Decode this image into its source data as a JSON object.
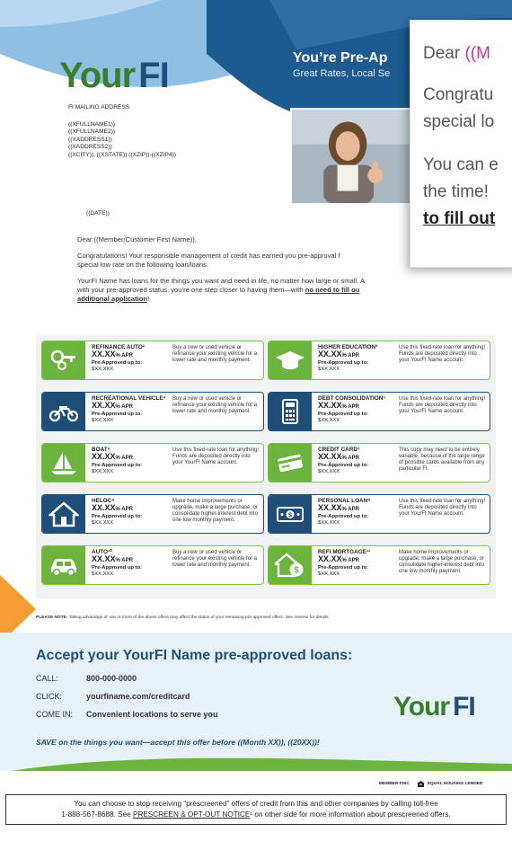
{
  "colors": {
    "brand_green": "#6cb33f",
    "brand_navy": "#1f4e79",
    "header_blue": "#1d5a8f",
    "accent_pink": "#c8358e",
    "accent_orange": "#f39c32"
  },
  "logo": {
    "part1": "Your",
    "part2": "FI"
  },
  "header": {
    "headline": "You’re Pre-Ap",
    "subline": "Great Rates, Local Se"
  },
  "address": {
    "label": "FI MAILING ADDRESS",
    "lines": [
      "((XFULLNAME1))",
      "((XFULLNAME2))",
      "((XADDRESS1))",
      "((XADDRESS2))",
      "((XCITY)), ((XSTATE)) ((XZIP))-((XZIP4))"
    ]
  },
  "date": "((DATE))",
  "letter": {
    "greeting": "Dear ((Member/Customer First Name)),",
    "p1": "Congratulations! Your responsible management of credit has earned you pre-approval f",
    "p1b": "special low rate on the following loan/loans.",
    "p2": "YourFI Name has loans for the things you want and need in life, no matter how large or small. A",
    "p2b": "with your pre-approved status, you’re one step closer to having them—with ",
    "p2_link": "no need to fill ou",
    "p2_link2": "additional application",
    "p2_end": "!"
  },
  "popup": {
    "line1_a": "Dear ",
    "line1_b": "((M",
    "line2": "Congratu",
    "line3": "special lo",
    "line4": "You can e",
    "line5": "the time!",
    "line6": "to fill out"
  },
  "offers": [
    {
      "name": "REFINANCE AUTO²",
      "rate": "XX.XX",
      "unit": "% APR",
      "pre": "Pre-Approved up to:",
      "amount": "$XX,XXX",
      "desc": "Buy a new or used vehicle or refinance your existing vehicle for a lower rate and monthly payment.",
      "icon": "car-keys-icon",
      "style": "green"
    },
    {
      "name": "HIGHER EDUCATION³",
      "rate": "XX.XX",
      "unit": "% APR",
      "pre": "Pre-Approved up to:",
      "amount": "$XX,XXX",
      "desc": "Use this fixed-rate loan for anything! Funds are deposited directly into your YourFI Name account.",
      "icon": "graduation-cap-icon",
      "style": "green"
    },
    {
      "name": "RECREATIONAL VEHICLE⁴",
      "rate": "XX.XX",
      "unit": "% APR",
      "pre": "Pre-Approved up to:",
      "amount": "$XX,XXX",
      "desc": "Buy a new or used vehicle or refinance your existing vehicle for a lower rate and monthly payment.",
      "icon": "motorcycle-icon",
      "style": "navy"
    },
    {
      "name": "DEBT CONSOLIDATION⁵",
      "rate": "XX.XX",
      "unit": "% APR",
      "pre": "Pre-Approved up to:",
      "amount": "$XX,XXX",
      "desc": "Use this fixed-rate loan for anything! Funds are deposited directly into your YourFI Name account.",
      "icon": "calculator-icon",
      "style": "navy"
    },
    {
      "name": "BOAT⁶",
      "rate": "XX.XX",
      "unit": "% APR",
      "pre": "Pre-Approved up to:",
      "amount": "$XX,XXX",
      "desc": "Use this fixed-rate loan for anything! Funds are deposited directly into your YourFI Name account.",
      "icon": "sailboat-icon",
      "style": "green"
    },
    {
      "name": "CREDIT CARD⁷",
      "rate": "XX.XX",
      "unit": "% APR",
      "pre": "Pre-Approved up to:",
      "amount": "$XX,XXX",
      "desc": "This copy may need to be entirely variable, because of the large range of possible cards available from any particular FI.",
      "icon": "credit-card-icon",
      "style": "green"
    },
    {
      "name": "HELOC⁸",
      "rate": "XX.XX",
      "unit": "% APR",
      "pre": "Pre-Approved up to:",
      "amount": "$XX,XXX",
      "desc": "Make home improvements or upgrade, make a large purchase, or consolidate higher-interest debt into one low monthly payment.",
      "icon": "house-icon",
      "style": "navy"
    },
    {
      "name": "PERSONAL LOAN⁹",
      "rate": "XX.XX",
      "unit": "% APR",
      "pre": "Pre-Approved up to:",
      "amount": "$XX,XXX",
      "desc": "Use this fixed-rate loan for anything! Funds are deposited directly into your YourFI Name account.",
      "icon": "cash-icon",
      "style": "navy"
    },
    {
      "name": "AUTO¹⁰",
      "rate": "XX.XX",
      "unit": "% APR",
      "pre": "Pre-Approved up to:",
      "amount": "$XX,XXX",
      "desc": "Buy a new or used vehicle or refinance your existing vehicle for a lower rate and monthly payment.",
      "icon": "car-icon",
      "style": "green"
    },
    {
      "name": "REFI MORTGAGE¹¹",
      "rate": "XX.XX",
      "unit": "% APR",
      "pre": "Pre-Approved up to:",
      "amount": "$XX,XXX",
      "desc": "Make home improvements or upgrade, make a large purchase, or consolidate higher-interest debt into one low monthly payment.",
      "icon": "house-dollar-icon",
      "style": "green"
    }
  ],
  "note": {
    "label": "PLEASE NOTE:",
    "text": " Taking advantage of one or more of the above offers may affect the status of your remaining pre-approved offers. See reverse for details."
  },
  "accept": {
    "title": "Accept your YourFI Name pre-approved loans:",
    "call_label": "CALL:",
    "call_value": "800-000-0000",
    "click_label": "CLICK:",
    "click_value": "yourfiname.com/creditcard",
    "comein_label": "COME IN:",
    "comein_value": "Convenient locations to serve you",
    "save": "SAVE on the things you want—accept this offer before ((Month XX)), ((20XX))!"
  },
  "legal": {
    "fdic": "MEMBER FDIC",
    "housing": "EQUAL HOUSING LENDER"
  },
  "optout": {
    "line1": "You can choose to stop receiving “prescreened” offers of credit from this and other companies by calling toll-free",
    "line2a": "1-888-567-8688. See ",
    "line2_link": "PRESCREEN & OPT-OUT NOTICE",
    "line2b": "¹ on other side for more information about prescreened offers."
  }
}
